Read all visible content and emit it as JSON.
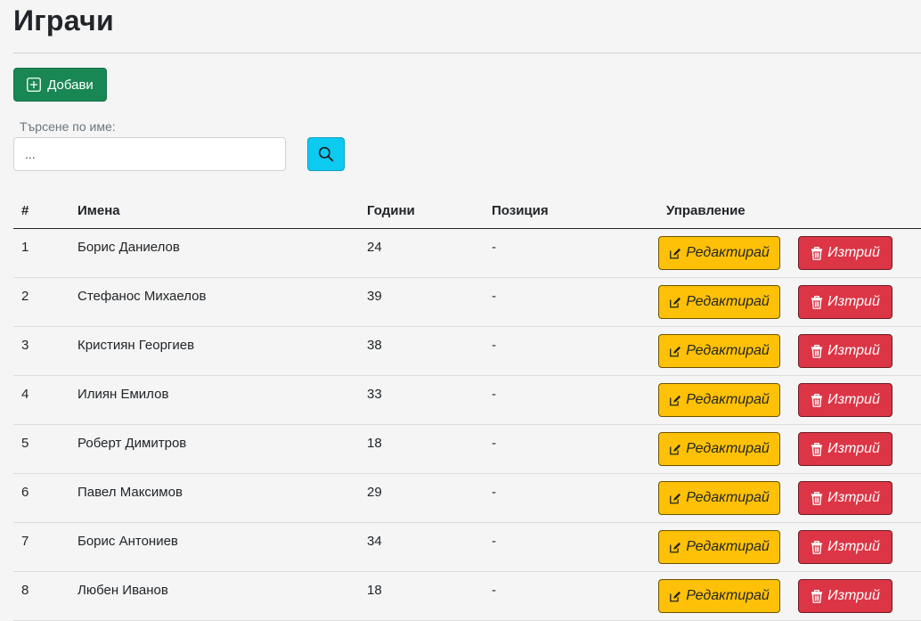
{
  "page": {
    "title": "Играчи"
  },
  "toolbar": {
    "add_label": "Добави"
  },
  "search": {
    "label": "Търсене по име:",
    "placeholder": "...",
    "value": ""
  },
  "table": {
    "headers": [
      "#",
      "Имена",
      "Години",
      "Позиция",
      "Управление"
    ],
    "edit_label": "Редактирай",
    "delete_label": "Изтрий",
    "rows": [
      {
        "num": "1",
        "name": "Борис Даниелов",
        "age": "24",
        "position": "-"
      },
      {
        "num": "2",
        "name": "Стефанос Михаелов",
        "age": "39",
        "position": "-"
      },
      {
        "num": "3",
        "name": "Кристиян Георгиев",
        "age": "38",
        "position": "-"
      },
      {
        "num": "4",
        "name": "Илиян Емилов",
        "age": "33",
        "position": "-"
      },
      {
        "num": "5",
        "name": "Роберт Димитров",
        "age": "18",
        "position": "-"
      },
      {
        "num": "6",
        "name": "Павел Максимов",
        "age": "29",
        "position": "-"
      },
      {
        "num": "7",
        "name": "Борис Антониев",
        "age": "34",
        "position": "-"
      },
      {
        "num": "8",
        "name": "Любен Иванов",
        "age": "18",
        "position": "-"
      }
    ]
  },
  "colors": {
    "success": "#198754",
    "info": "#0dcaf0",
    "warning": "#ffc107",
    "danger": "#dc3545"
  },
  "icons": {
    "add": "plus-square-icon",
    "search": "search-icon",
    "edit": "pencil-square-icon",
    "delete": "trash-icon"
  }
}
